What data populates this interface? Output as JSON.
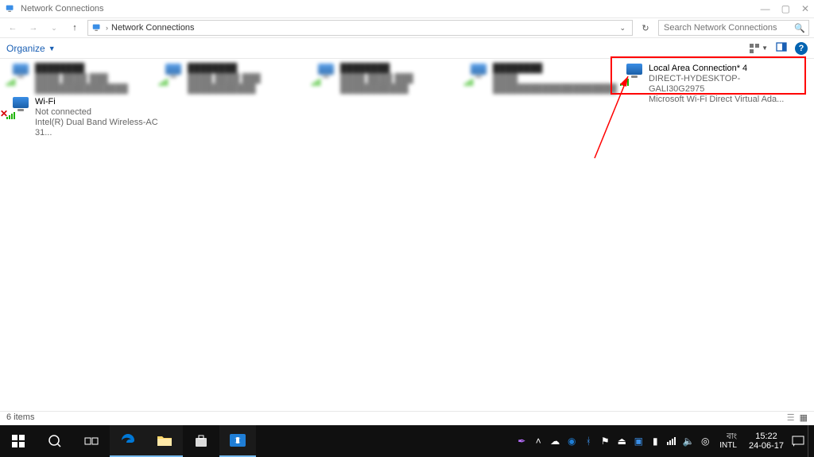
{
  "window": {
    "title": "Network Connections",
    "breadcrumb": "Network Connections",
    "search_placeholder": "Search Network Connections"
  },
  "cmdbar": {
    "organize": "Organize"
  },
  "adapters": {
    "wifi": {
      "name": "Wi-Fi",
      "status": "Not connected",
      "device": "Intel(R) Dual Band Wireless-AC 31..."
    },
    "lac4": {
      "name": "Local Area Connection* 4",
      "status": "DIRECT-HYDESKTOP-GALI30G2975",
      "device": "Microsoft Wi-Fi Direct Virtual Ada..."
    }
  },
  "statusbar": {
    "items": "6 items"
  },
  "taskbar": {
    "lang_top": "বাং",
    "lang_bottom": "INTL",
    "time": "15:22",
    "date": "24-06-17"
  }
}
